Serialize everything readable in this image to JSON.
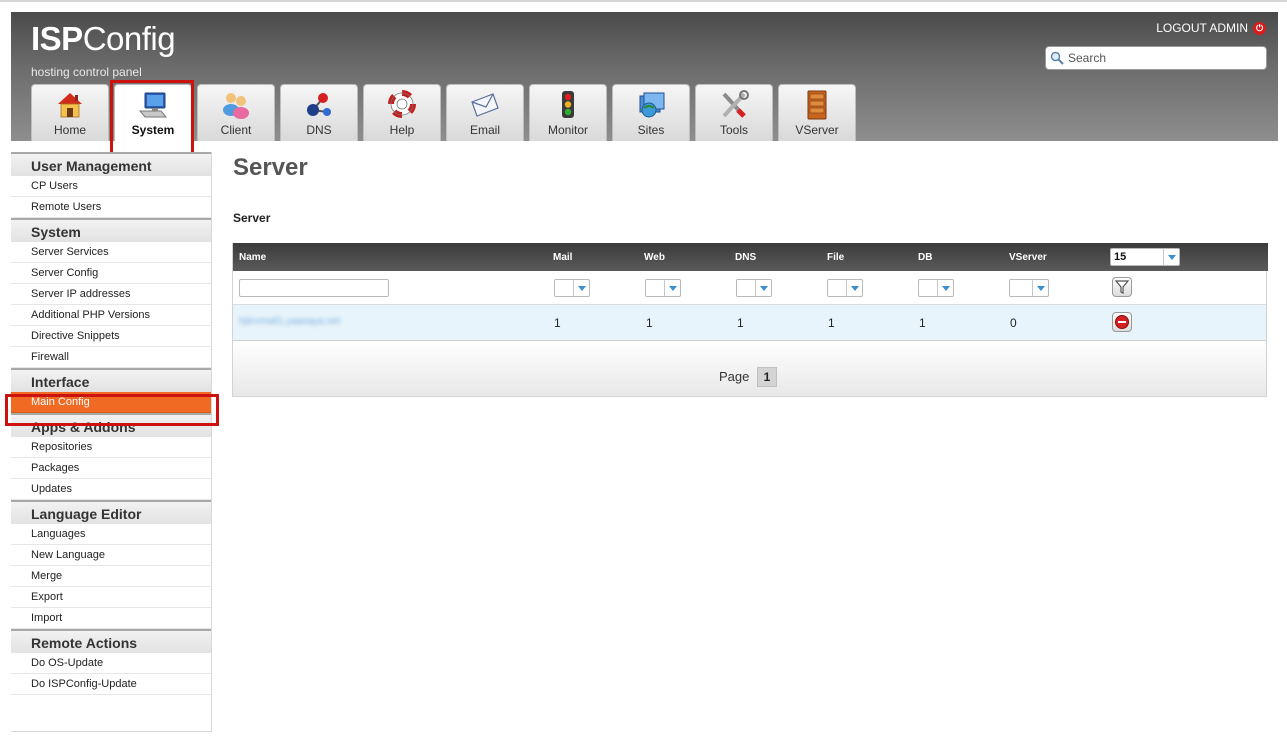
{
  "app": {
    "logo_bold": "ISP",
    "logo_rest": "Config",
    "subtitle": "hosting control panel",
    "logout_label": "LOGOUT ADMIN",
    "search_placeholder": "Search"
  },
  "tabs": [
    {
      "label": "Home",
      "icon": "home-icon",
      "active": false
    },
    {
      "label": "System",
      "icon": "computer-icon",
      "active": true
    },
    {
      "label": "Client",
      "icon": "users-icon",
      "active": false
    },
    {
      "label": "DNS",
      "icon": "network-icon",
      "active": false
    },
    {
      "label": "Help",
      "icon": "lifebuoy-icon",
      "active": false
    },
    {
      "label": "Email",
      "icon": "envelope-icon",
      "active": false
    },
    {
      "label": "Monitor",
      "icon": "traffic-light-icon",
      "active": false
    },
    {
      "label": "Sites",
      "icon": "sites-icon",
      "active": false
    },
    {
      "label": "Tools",
      "icon": "tools-icon",
      "active": false
    },
    {
      "label": "VServer",
      "icon": "cabinet-icon",
      "active": false
    }
  ],
  "sidebar": {
    "groups": [
      {
        "title": "User Management",
        "items": [
          "CP Users",
          "Remote Users"
        ]
      },
      {
        "title": "System",
        "items": [
          "Server Services",
          "Server Config",
          "Server IP addresses",
          "Additional PHP Versions",
          "Directive Snippets",
          "Firewall"
        ]
      },
      {
        "title": "Interface",
        "items": [
          "Main Config"
        ]
      },
      {
        "title": "Apps & Addons",
        "items": [
          "Repositories",
          "Packages",
          "Updates"
        ]
      },
      {
        "title": "Language Editor",
        "items": [
          "Languages",
          "New Language",
          "Merge",
          "Export",
          "Import"
        ]
      },
      {
        "title": "Remote Actions",
        "items": [
          "Do OS-Update",
          "Do ISPConfig-Update"
        ]
      }
    ],
    "active_item": "Main Config"
  },
  "main": {
    "page_title": "Server",
    "section_title": "Server",
    "table": {
      "columns": [
        "Name",
        "Mail",
        "Web",
        "DNS",
        "File",
        "DB",
        "VServer"
      ],
      "per_page": "15",
      "rows": [
        {
          "name": "hjiirvmail1.yaasaya.net",
          "mail": "1",
          "web": "1",
          "dns": "1",
          "file": "1",
          "db": "1",
          "vserver": "0"
        }
      ]
    },
    "pager": {
      "label": "Page",
      "current": "1"
    }
  },
  "colors": {
    "accent_active": "#f06a24",
    "header_dark": "#4a4a4a",
    "highlight_box": "#cc1111",
    "row_bg": "#e8f4fb"
  }
}
